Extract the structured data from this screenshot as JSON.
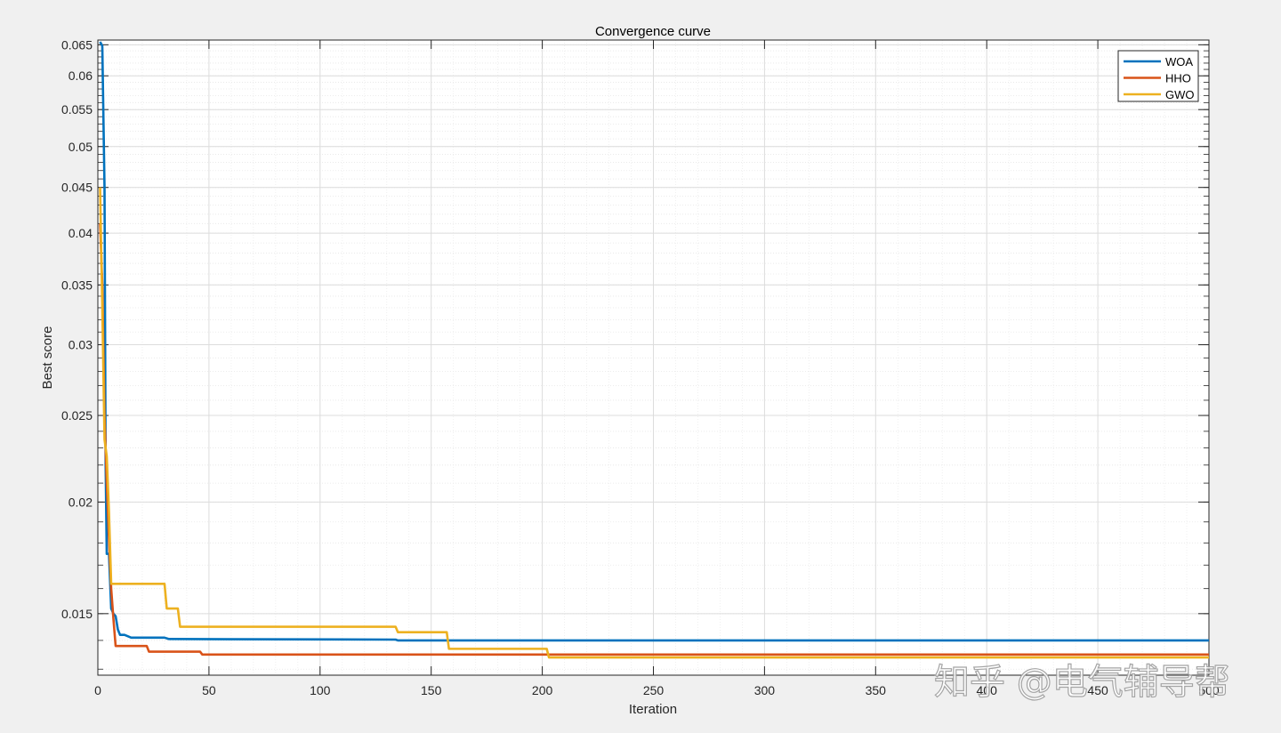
{
  "chart_data": {
    "type": "line",
    "title": "Convergence curve",
    "xlabel": "Iteration",
    "ylabel": "Best score",
    "xlim": [
      0,
      500
    ],
    "ylim": [
      0.0128,
      0.0658
    ],
    "yscale": "log",
    "grid": true,
    "minor_grid": true,
    "legend_position": "top-right",
    "x_ticks": [
      0,
      50,
      100,
      150,
      200,
      250,
      300,
      350,
      400,
      450,
      500
    ],
    "x_tick_labels": [
      "0",
      "50",
      "100",
      "150",
      "200",
      "250",
      "300",
      "350",
      "400",
      "450",
      "500"
    ],
    "y_ticks": [
      0.015,
      0.02,
      0.025,
      0.03,
      0.035,
      0.04,
      0.045,
      0.05,
      0.055,
      0.06,
      0.065
    ],
    "y_tick_labels": [
      "0.015",
      "0.02",
      "0.025",
      "0.03",
      "0.035",
      "0.04",
      "0.045",
      "0.05",
      "0.055",
      "0.06",
      "0.065"
    ],
    "series": [
      {
        "name": "WOA",
        "color": "#0072BD",
        "points": [
          [
            1,
            0.0655
          ],
          [
            2,
            0.0648
          ],
          [
            3,
            0.045
          ],
          [
            3.5,
            0.022
          ],
          [
            4,
            0.0175
          ],
          [
            5,
            0.0175
          ],
          [
            6,
            0.0152
          ],
          [
            7,
            0.015
          ],
          [
            8,
            0.0149
          ],
          [
            9,
            0.0144
          ],
          [
            10,
            0.0142
          ],
          [
            12,
            0.0142
          ],
          [
            15,
            0.0141
          ],
          [
            30,
            0.0141
          ],
          [
            32,
            0.01405
          ],
          [
            134,
            0.01403
          ],
          [
            135,
            0.014
          ],
          [
            500,
            0.014
          ]
        ]
      },
      {
        "name": "HHO",
        "color": "#D95319",
        "points": [
          [
            1,
            0.041
          ],
          [
            2,
            0.035
          ],
          [
            3,
            0.025
          ],
          [
            4,
            0.021
          ],
          [
            5,
            0.0182
          ],
          [
            6,
            0.016
          ],
          [
            7,
            0.0148
          ],
          [
            8,
            0.0138
          ],
          [
            22,
            0.0138
          ],
          [
            23,
            0.0136
          ],
          [
            46,
            0.0136
          ],
          [
            47,
            0.0135
          ],
          [
            500,
            0.0135
          ]
        ]
      },
      {
        "name": "GWO",
        "color": "#EDB120",
        "points": [
          [
            1,
            0.045
          ],
          [
            2,
            0.033
          ],
          [
            3,
            0.0235
          ],
          [
            4,
            0.0225
          ],
          [
            5,
            0.0195
          ],
          [
            6,
            0.0162
          ],
          [
            30,
            0.0162
          ],
          [
            31,
            0.0152
          ],
          [
            36,
            0.0152
          ],
          [
            37,
            0.0145
          ],
          [
            134,
            0.0145
          ],
          [
            135,
            0.0143
          ],
          [
            157,
            0.0143
          ],
          [
            158,
            0.0137
          ],
          [
            202,
            0.0137
          ],
          [
            203,
            0.0134
          ],
          [
            500,
            0.0134
          ]
        ]
      }
    ]
  },
  "watermark": {
    "text": "知乎 @电气辅导帮"
  }
}
